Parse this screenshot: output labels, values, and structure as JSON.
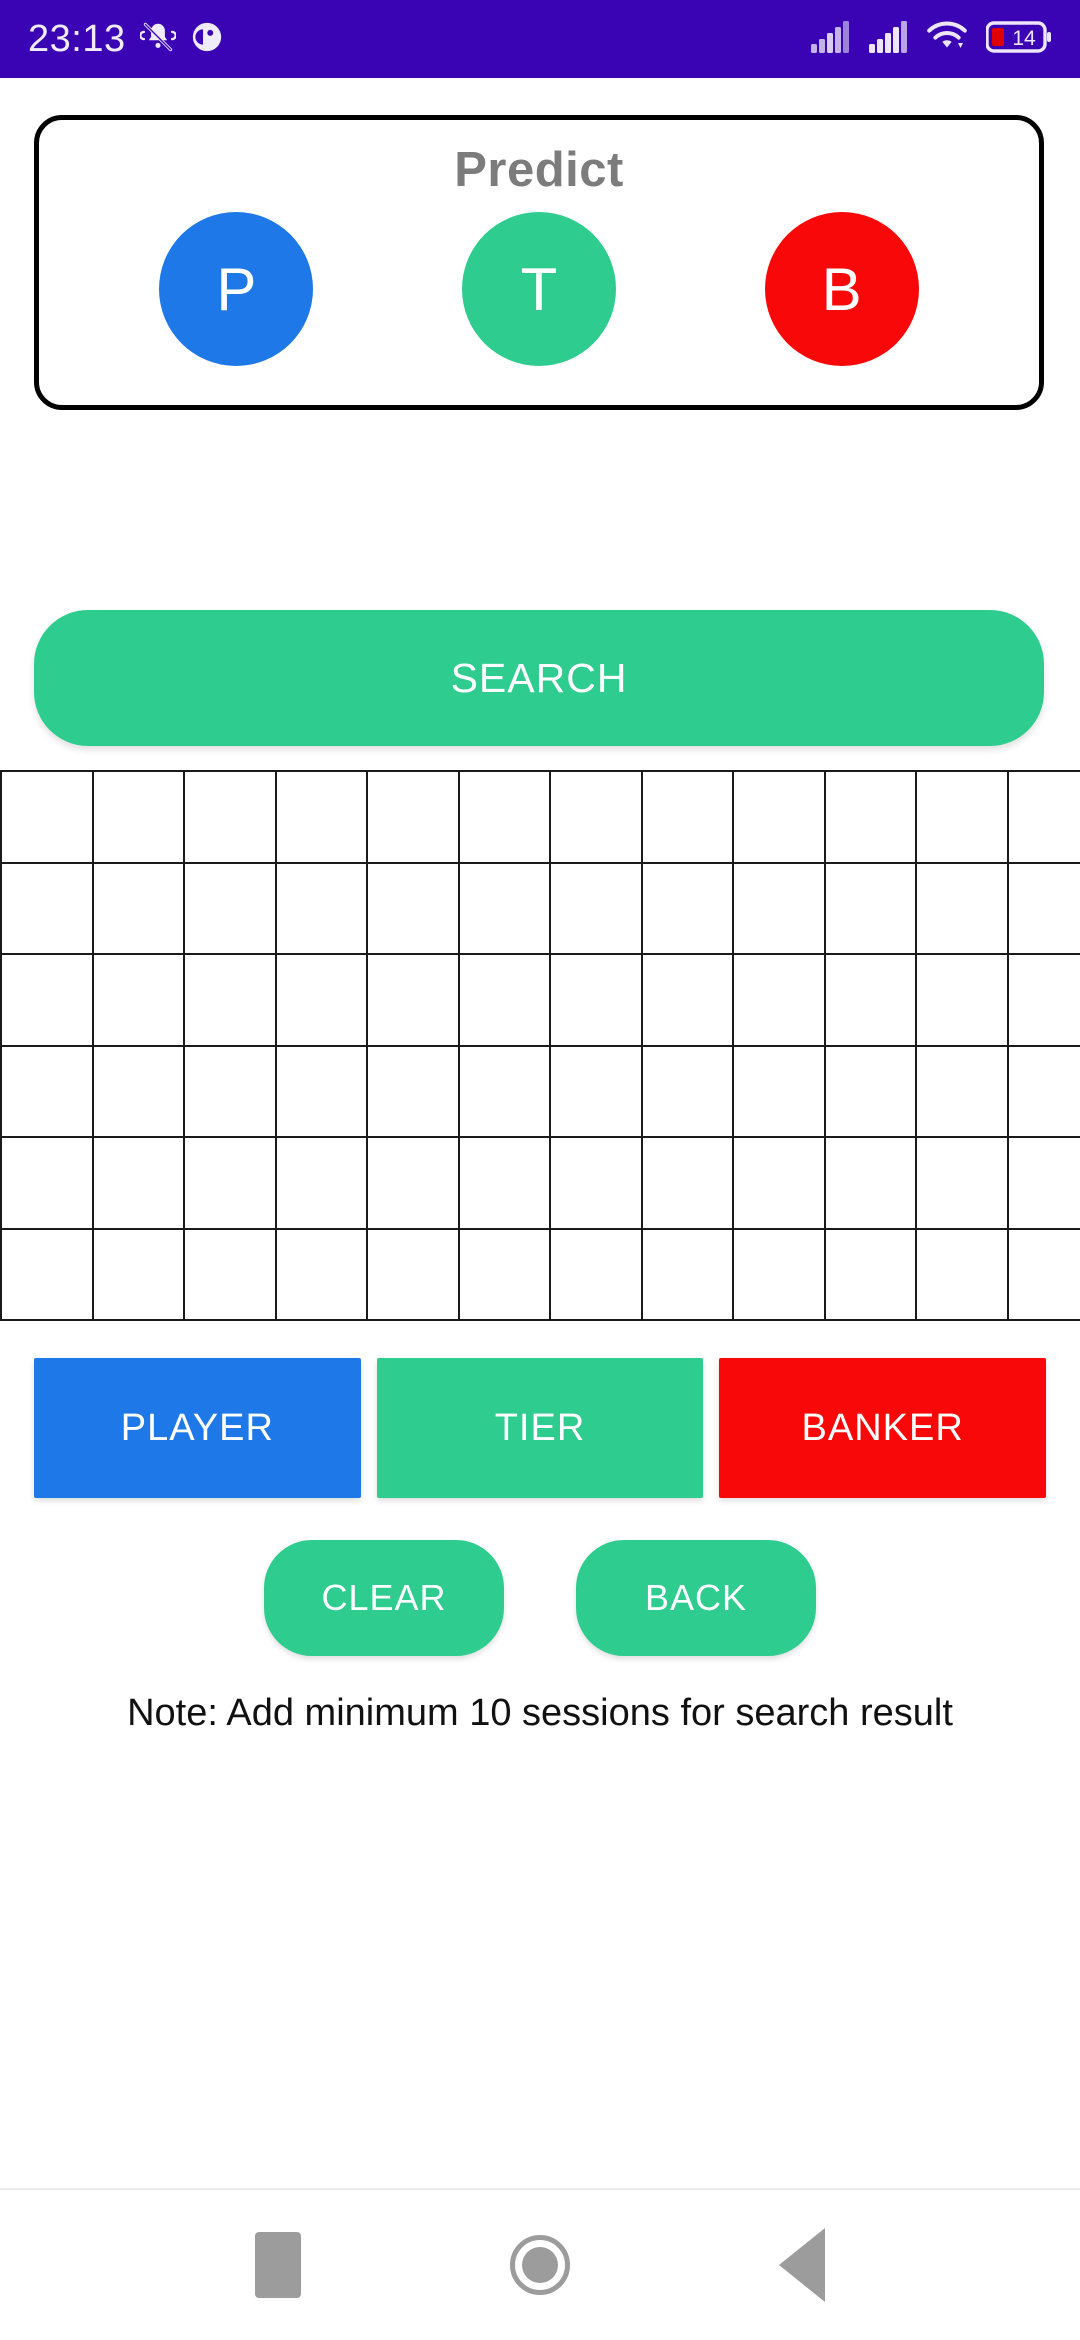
{
  "status_bar": {
    "time": "23:13",
    "background_color": "#3A04B5",
    "icons": [
      "bell-muted-icon",
      "app-circle-icon",
      "signal-bars-icon",
      "signal-bars-2-icon",
      "wifi-icon",
      "battery-icon"
    ],
    "battery_level": "14"
  },
  "predict_card": {
    "title": "Predict",
    "options": [
      {
        "label": "P",
        "name": "player",
        "color": "#1E78E8"
      },
      {
        "label": "T",
        "name": "tie",
        "color": "#2ECC8F"
      },
      {
        "label": "B",
        "name": "banker",
        "color": "#F80808"
      }
    ]
  },
  "search": {
    "label": "SEARCH",
    "color": "#2ECC8F"
  },
  "grid": {
    "rows": 6,
    "columns": 12,
    "cells": []
  },
  "outcome_buttons": [
    {
      "label": "PLAYER",
      "color": "#1E78E8"
    },
    {
      "label": "TIER",
      "color": "#2ECC8F"
    },
    {
      "label": "BANKER",
      "color": "#F80808"
    }
  ],
  "action_buttons": [
    {
      "label": "CLEAR",
      "color": "#2ECC8F"
    },
    {
      "label": "BACK",
      "color": "#2ECC8F"
    }
  ],
  "note": {
    "text": "Note: Add minimum 10 sessions for search result"
  },
  "nav_bar": {
    "items": [
      "recents-square-icon",
      "home-circle-icon",
      "back-triangle-icon"
    ]
  }
}
